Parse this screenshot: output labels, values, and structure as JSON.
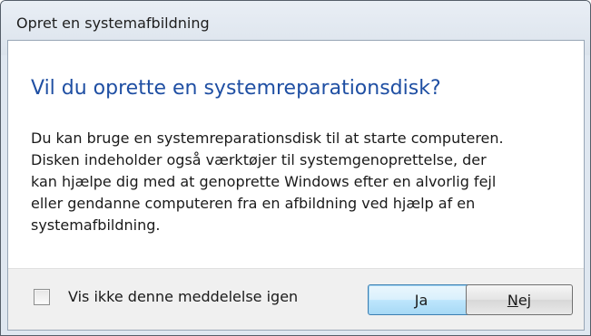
{
  "window": {
    "title": "Opret en systemafbildning"
  },
  "dialog": {
    "instruction": "Vil du oprette en systemreparationsdisk?",
    "content_lines": [
      "Du kan bruge en systemreparationsdisk til at starte computeren.",
      "Disken indeholder også værktøjer til systemgenoprettelse, der",
      "kan hjælpe dig med at genoprette Windows efter en alvorlig fejl",
      "eller gendanne computeren fra en afbildning ved hjælp af en",
      "systemafbildning."
    ]
  },
  "footer": {
    "checkbox_label": "Vis ikke denne meddelelse igen",
    "checkbox_checked": false,
    "yes_label": "Ja",
    "no_label_prefix": "",
    "no_label_mnemonic": "N",
    "no_label_suffix": "ej"
  },
  "colors": {
    "instruction": "#1f4fa3",
    "default_button_border": "#3c7fb1"
  }
}
